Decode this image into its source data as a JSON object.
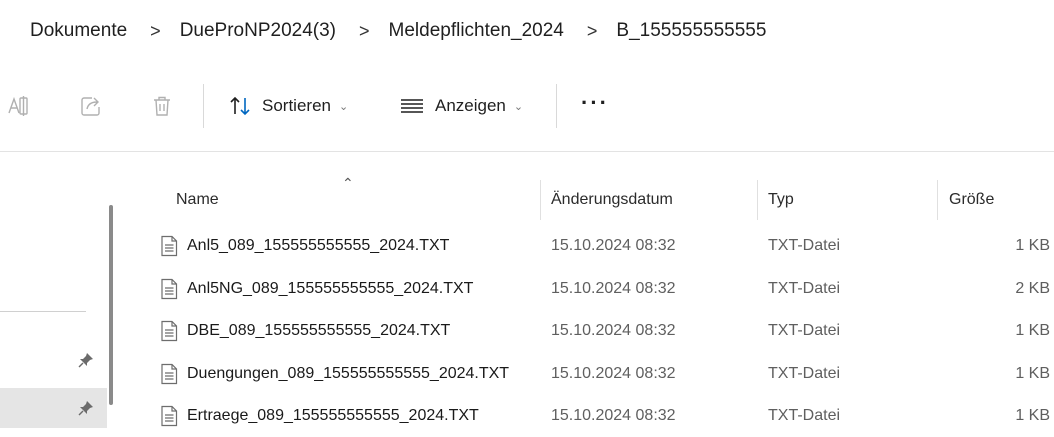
{
  "breadcrumb": {
    "items": [
      "Dokumente",
      "DueProNP2024(3)",
      "Meldepflichten_2024",
      "B_155555555555"
    ],
    "separator": ">"
  },
  "toolbar": {
    "sort_label": "Sortieren",
    "view_label": "Anzeigen",
    "more_label": "···",
    "icons": [
      "rename-icon",
      "share-icon",
      "delete-icon",
      "sort-icon",
      "view-icon",
      "more-icon",
      "chevron-down-icon"
    ]
  },
  "columns": {
    "name": "Name",
    "date": "Änderungsdatum",
    "type": "Typ",
    "size": "Größe"
  },
  "files": [
    {
      "name": "Anl5_089_155555555555_2024.TXT",
      "date": "15.10.2024 08:32",
      "type": "TXT-Datei",
      "size": "1 KB"
    },
    {
      "name": "Anl5NG_089_155555555555_2024.TXT",
      "date": "15.10.2024 08:32",
      "type": "TXT-Datei",
      "size": "2 KB"
    },
    {
      "name": "DBE_089_155555555555_2024.TXT",
      "date": "15.10.2024 08:32",
      "type": "TXT-Datei",
      "size": "1 KB"
    },
    {
      "name": "Duengungen_089_155555555555_2024.TXT",
      "date": "15.10.2024 08:32",
      "type": "TXT-Datei",
      "size": "1 KB"
    },
    {
      "name": "Ertraege_089_155555555555_2024.TXT",
      "date": "15.10.2024 08:32",
      "type": "TXT-Datei",
      "size": "1 KB"
    }
  ],
  "colors": {
    "selected_nav": "#e5e5e5",
    "accent": "#0067c0"
  }
}
